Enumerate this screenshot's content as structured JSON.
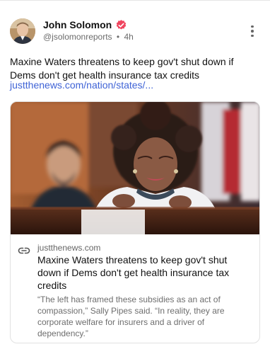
{
  "post": {
    "author_name": "John Solomon",
    "handle": "@jsolomonreports",
    "separator": "•",
    "time": "4h",
    "text": "Maxine Waters threatens to keep gov't shut down if Dems don't get health insurance tax credits",
    "link_text": "justthenews.com/nation/states/..."
  },
  "card": {
    "domain": "justthenews.com",
    "title": "Maxine Waters threatens to keep gov't shut down if Dems don't get health insurance tax credits",
    "description": "“The left has framed these subsidies as an act of compassion,” Sally Pipes said. “In reality, they are corporate welfare for insurers and a driver of dependency.”"
  },
  "icons": {
    "verified": "verified-badge-icon",
    "more": "more-vertical-icon",
    "link": "link-icon"
  },
  "colors": {
    "link": "#3f63d6",
    "verified_badge": "#f0455f",
    "muted_text": "#6b6b6b"
  }
}
